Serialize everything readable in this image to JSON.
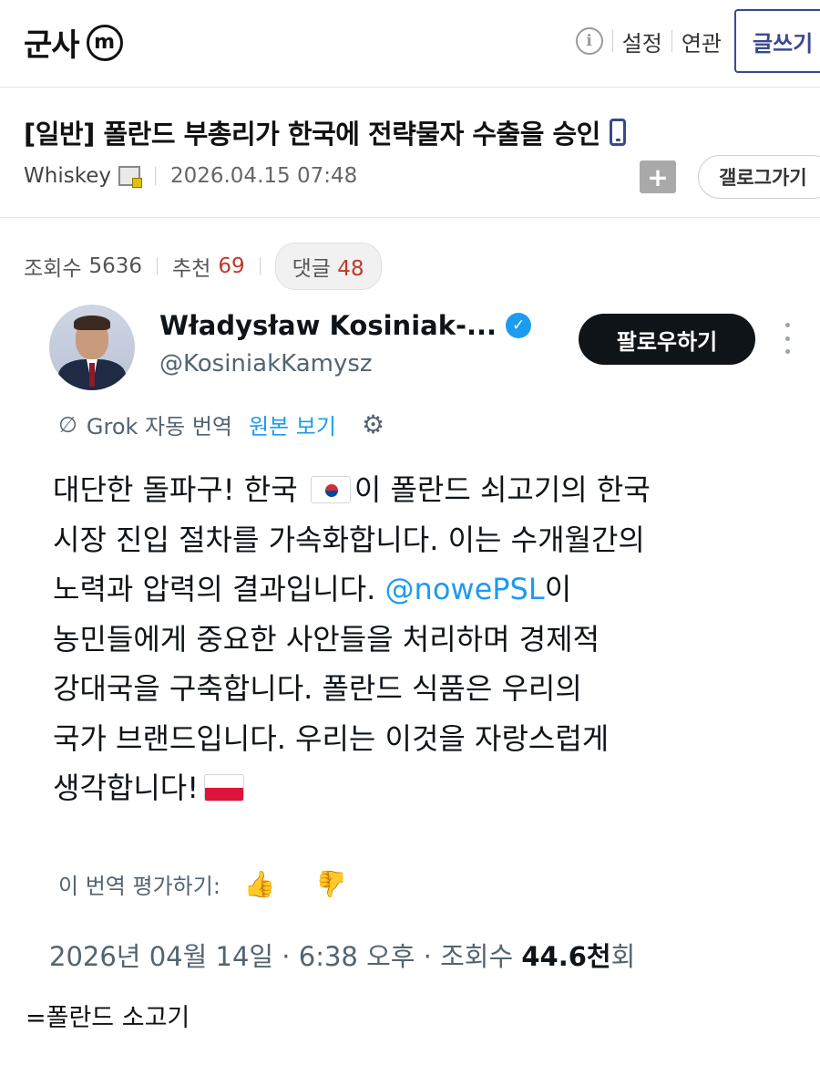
{
  "header": {
    "brand": "군사",
    "brand_logo": "m",
    "info_icon": "i",
    "settings_link": "설정",
    "related_link": "연관",
    "write_button": "글쓰기"
  },
  "post": {
    "title": "[일반] 폴란드 부총리가 한국에 전략물자 수출을 승인",
    "author": "Whiskey",
    "date": "2026.04.15 07:48",
    "bookmark_symbol": "+",
    "gallery_button": "갤로그가기",
    "stats": {
      "views_label": "조회수",
      "views": "5636",
      "recommend_label": "추천",
      "recommend": "69",
      "comments_label": "댓글",
      "comments": "48"
    },
    "comment": "=폴란드 소고기"
  },
  "tweet": {
    "name": "Władysław Kosiniak-...",
    "verified_symbol": "✓",
    "handle": "@KosiniakKamysz",
    "follow_button": "팔로우하기",
    "translation_label": "Grok 자동 번역",
    "original_link": "원본 보기",
    "lines": {
      "l1a": "대단한 돌파구! 한국",
      "l1b": "이 폴란드 쇠고기의 한국",
      "l2": "시장 진입 절차를 가속화합니다. 이는 수개월간의",
      "l3a": "노력과 압력의 결과입니다.",
      "l3_mention": "@nowePSL",
      "l3b": "이",
      "l4": "농민들에게 중요한 사안들을 처리하며 경제적",
      "l5": "강대국을 구축합니다. 폴란드 식품은 우리의",
      "l6": "국가 브랜드입니다. 우리는 이것을 자랑스럽게",
      "l7": "생각합니다!"
    },
    "rate_label": "이 번역 평가하기:",
    "meta_prefix": "2026년 04월 14일 · 6:38 오후 · 조회수",
    "meta_views": "44.6천",
    "meta_suffix": "회"
  },
  "icons": {
    "grok": "∅",
    "settings": "⚙",
    "thumb_up": "👍",
    "thumb_down": "👍"
  },
  "colors": {
    "accent": "#3b4890",
    "link_blue": "#1d9bf0",
    "count_red": "#c0392b",
    "follow_bg": "#0f1419"
  }
}
